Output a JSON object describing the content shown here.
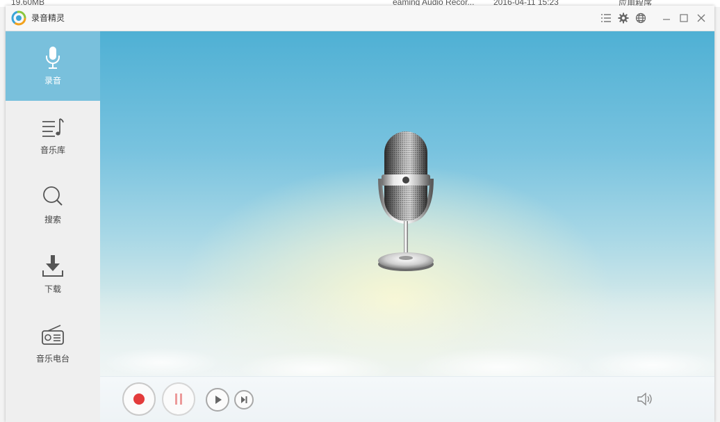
{
  "background_window": {
    "size_text": "19.60MB",
    "file_name": "eaming Audio Recor...",
    "date": "2016-04-11 15:23",
    "type": "应用程序"
  },
  "app": {
    "title": "录音精灵"
  },
  "titlebar_icons": [
    "list-icon",
    "gear-icon",
    "globe-icon",
    "minimize-icon",
    "maximize-icon",
    "close-icon"
  ],
  "sidebar": {
    "items": [
      {
        "label": "录音",
        "icon": "microphone-icon",
        "active": true
      },
      {
        "label": "音乐库",
        "icon": "music-library-icon",
        "active": false
      },
      {
        "label": "搜索",
        "icon": "search-icon",
        "active": false
      },
      {
        "label": "下载",
        "icon": "download-icon",
        "active": false
      },
      {
        "label": "音乐电台",
        "icon": "radio-icon",
        "active": false
      }
    ]
  },
  "colors": {
    "active_nav": "#79c0dc",
    "record_red": "#e33b3b",
    "pause_pink": "#ec9a9a"
  },
  "controls": [
    "record-button",
    "pause-button",
    "play-button",
    "next-button",
    "volume-icon"
  ]
}
